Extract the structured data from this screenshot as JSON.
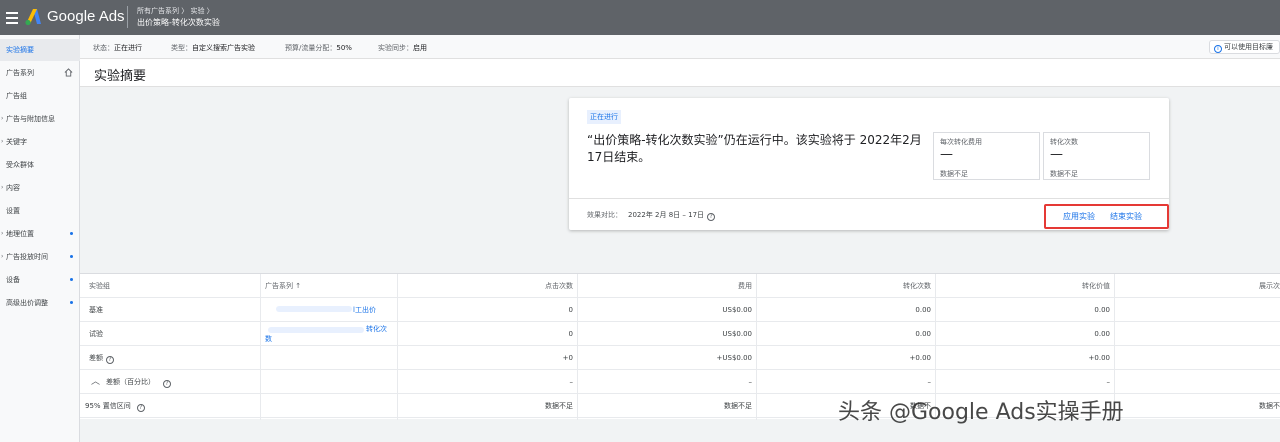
{
  "header": {
    "app_name": "Google Ads",
    "breadcrumb": "所有广告系列 〉 实验 〉",
    "current_title": "出价策略-转化次数实验"
  },
  "sidebar": {
    "items": [
      {
        "label": "实验摘要",
        "active": true
      },
      {
        "label": "广告系列",
        "icon": "home-icon"
      },
      {
        "label": "广告组"
      },
      {
        "label": "广告与附加信息",
        "caret": true
      },
      {
        "label": "关键字",
        "caret": true
      },
      {
        "label": "受众群体"
      },
      {
        "label": "内容",
        "caret": true
      },
      {
        "label": "设置"
      },
      {
        "label": "地理位置",
        "caret": true,
        "dot": true
      },
      {
        "label": "广告投放时间",
        "caret": true,
        "dot": true
      },
      {
        "label": "设备",
        "dot": true
      },
      {
        "label": "高级出价调整",
        "dot": true
      }
    ]
  },
  "status_bar": {
    "status_label": "状态：",
    "status_value": "正在进行",
    "type_label": "类型：",
    "type_value": "自定义搜索广告实验",
    "budget_label": "预算/流量分配：",
    "budget_value": "50%",
    "sync_label": "实验同步：",
    "sync_value": "启用",
    "tip": "可以使用目标廉"
  },
  "page": {
    "title": "实验摘要"
  },
  "summary_card": {
    "badge": "正在进行",
    "message": "“出价策略-转化次数实验”仍在运行中。该实验将于 2022年2月17日结束。",
    "metric1": {
      "label": "每次转化费用",
      "value": "—",
      "sub": "数据不足"
    },
    "metric2": {
      "label": "转化次数",
      "value": "—",
      "sub": "数据不足"
    },
    "range_label": "效果对比：",
    "range_value": "2022年 2月 8日 – 17日",
    "apply_label": "应用实验",
    "end_label": "结束实验"
  },
  "table": {
    "headers": [
      "实验组",
      "广告系列 ↑",
      "点击次数",
      "费用",
      "转化次数",
      "转化价值",
      "展示次"
    ],
    "rows": [
      {
        "group": "基准",
        "campaign": "l工出价",
        "clicks": "0",
        "cost": "US$0.00",
        "conv": "0.00",
        "value": "0.00"
      },
      {
        "group": "试验",
        "campaign": "转化次",
        "campaign2": "数",
        "clicks": "0",
        "cost": "US$0.00",
        "conv": "0.00",
        "value": "0.00"
      },
      {
        "group": "差额",
        "clicks": "+0",
        "cost": "+US$0.00",
        "conv": "+0.00",
        "value": "+0.00"
      },
      {
        "group": "差额（百分比）",
        "clicks": "–",
        "cost": "–",
        "conv": "–",
        "value": "–"
      },
      {
        "group": "95% 置信区间",
        "clicks": "数据不足",
        "cost": "数据不足",
        "conv": "数据不",
        "value": "",
        "extra": "数据不"
      }
    ]
  },
  "watermark": "头条 @Google Ads实操手册"
}
